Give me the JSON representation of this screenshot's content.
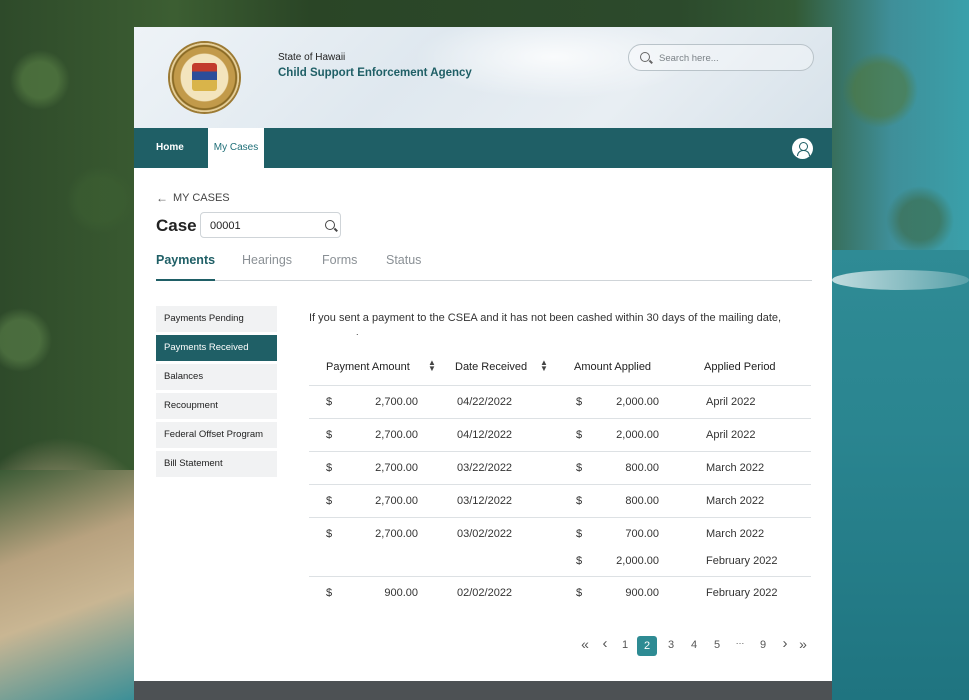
{
  "header": {
    "state_label": "State of Hawaii",
    "agency_name": "Child Support Enforcement Agency",
    "logo": "state-seal-icon",
    "search_placeholder": "Search here..."
  },
  "nav": {
    "items": [
      {
        "label": "Home"
      },
      {
        "label": "My Cases"
      }
    ],
    "active": "My Cases",
    "user_icon": "user-icon"
  },
  "case": {
    "back_label": "MY CASES",
    "label": "Case",
    "number": "00001"
  },
  "tabs": [
    {
      "label": "Payments"
    },
    {
      "label": "Hearings"
    },
    {
      "label": "Forms"
    },
    {
      "label": "Status"
    }
  ],
  "active_tab": "Payments",
  "sidebar": {
    "items": [
      {
        "label": "Payments Pending"
      },
      {
        "label": "Payments Received"
      },
      {
        "label": "Balances"
      },
      {
        "label": "Recoupment"
      },
      {
        "label": "Federal Offset Program"
      },
      {
        "label": "Bill Statement"
      }
    ],
    "active": "Payments Received"
  },
  "main": {
    "intro": "If you sent a payment to the CSEA and it has not been cashed within 30 days of the mailing date,",
    "intro_cont": "."
  },
  "table": {
    "headers": [
      "Payment Amount",
      "Date Received",
      "Amount Applied",
      "Applied Period"
    ],
    "currency": "$",
    "rows": [
      {
        "amount": "2,700.00",
        "date": "04/22/2022",
        "applied": [
          {
            "amount": "2,000.00",
            "period": "April 2022"
          }
        ]
      },
      {
        "amount": "2,700.00",
        "date": "04/12/2022",
        "applied": [
          {
            "amount": "2,000.00",
            "period": "April 2022"
          }
        ]
      },
      {
        "amount": "2,700.00",
        "date": "03/22/2022",
        "applied": [
          {
            "amount": "800.00",
            "period": "March 2022"
          }
        ]
      },
      {
        "amount": "2,700.00",
        "date": "03/12/2022",
        "applied": [
          {
            "amount": "800.00",
            "period": "March 2022"
          }
        ]
      },
      {
        "amount": "2,700.00",
        "date": "03/02/2022",
        "applied": [
          {
            "amount": "700.00",
            "period": "March 2022"
          },
          {
            "amount": "2,000.00",
            "period": "February 2022"
          }
        ]
      },
      {
        "amount": "900.00",
        "date": "02/02/2022",
        "applied": [
          {
            "amount": "900.00",
            "period": "February 2022"
          }
        ]
      }
    ]
  },
  "pagination": {
    "first": "«",
    "prev": "‹",
    "pages": [
      "1",
      "2",
      "3",
      "4",
      "5",
      "…",
      "9"
    ],
    "current": "2",
    "next": "›",
    "last": "»"
  },
  "colors": {
    "primary": "#1f5f66",
    "accent": "#2e8b93",
    "footer": "#4d5154"
  }
}
